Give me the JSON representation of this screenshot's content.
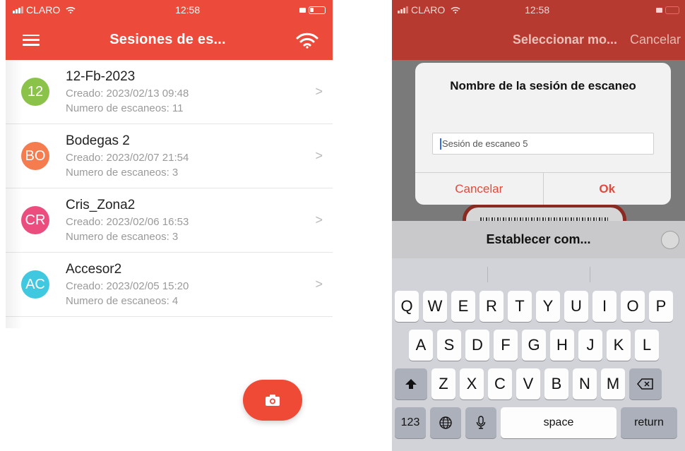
{
  "left": {
    "status": {
      "carrier": "CLARO",
      "time": "12:58"
    },
    "appbar": {
      "title": "Sesiones de es..."
    },
    "sessions": [
      {
        "initials": "12",
        "color": "#8bc34a",
        "name": "12-Fb-2023",
        "created": "Creado: 2023/02/13 09:48",
        "scans": "Numero de escaneos: 11"
      },
      {
        "initials": "BO",
        "color": "#f47c4f",
        "name": "Bodegas 2",
        "created": "Creado: 2023/02/07 21:54",
        "scans": "Numero de escaneos: 3"
      },
      {
        "initials": "CR",
        "color": "#eb4e7e",
        "name": "Cris_Zona2",
        "created": "Creado: 2023/02/06 16:53",
        "scans": "Numero de escaneos: 3"
      },
      {
        "initials": "AC",
        "color": "#3fc8e0",
        "name": "Accesor2",
        "created": "Creado: 2023/02/05 15:20",
        "scans": "Numero de escaneos: 4"
      }
    ],
    "chevron": ">"
  },
  "right": {
    "status": {
      "carrier": "CLARO",
      "time": "12:58"
    },
    "appbar": {
      "title": "Seleccionar mo...",
      "cancel": "Cancelar"
    },
    "dialog": {
      "title": "Nombre de la sesión de escaneo",
      "placeholder": "Sesión de escaneo 5",
      "cancel": "Cancelar",
      "ok": "Ok"
    },
    "bar": {
      "label": "Establecer com..."
    },
    "keyboard": {
      "row1": [
        "Q",
        "W",
        "E",
        "R",
        "T",
        "Y",
        "U",
        "I",
        "O",
        "P"
      ],
      "row2": [
        "A",
        "S",
        "D",
        "F",
        "G",
        "H",
        "J",
        "K",
        "L"
      ],
      "row3": [
        "Z",
        "X",
        "C",
        "V",
        "B",
        "N",
        "M"
      ],
      "numbers": "123",
      "space": "space",
      "return": "return"
    }
  },
  "colors": {
    "brand_red": "#ec4b3c",
    "dim_red": "#b63a2f"
  }
}
